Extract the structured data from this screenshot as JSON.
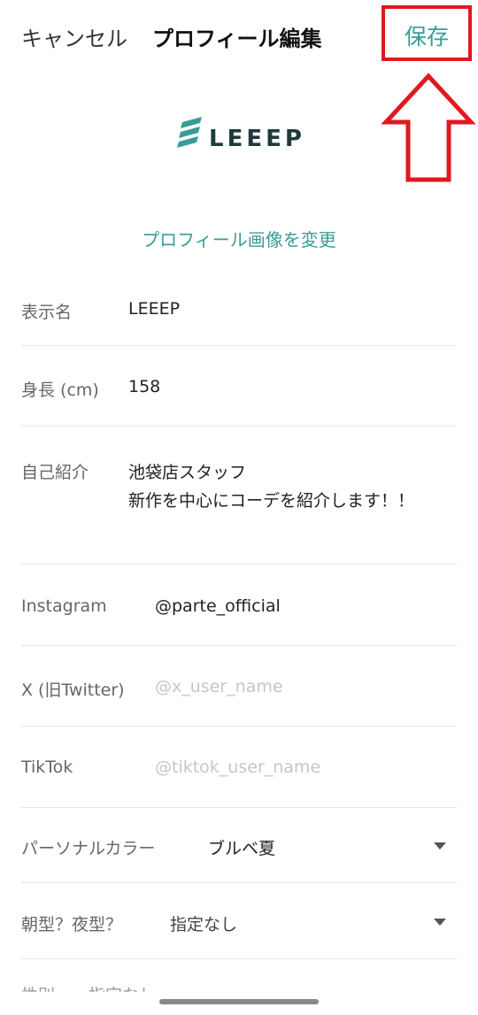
{
  "header": {
    "cancel_label": "キャンセル",
    "title": "プロフィール編集",
    "save_label": "保存"
  },
  "logo": {
    "text": "LEEEP"
  },
  "profile": {
    "change_photo_label": "プロフィール画像を変更"
  },
  "fields": {
    "display_name": {
      "label": "表示名",
      "value": "LEEEP"
    },
    "height": {
      "label": "身長 (cm)",
      "value": "158"
    },
    "bio": {
      "label": "自己紹介",
      "line1": "池袋店スタッフ",
      "line2": "新作を中心にコーデを紹介します！！"
    },
    "instagram": {
      "label": "Instagram",
      "value": "@parte_official"
    },
    "x_twitter": {
      "label": "X (旧Twitter)",
      "placeholder": "@x_user_name"
    },
    "tiktok": {
      "label": "TikTok",
      "placeholder": "@tiktok_user_name"
    },
    "personal_color": {
      "label": "パーソナルカラー",
      "value": "ブルベ夏"
    },
    "morning_night": {
      "label": "朝型？夜型？",
      "value": "指定なし"
    },
    "gender_cutoff": {
      "text": "性別　　指定なし"
    }
  },
  "colors": {
    "accent": "#3a9c95",
    "highlight": "#e0181f"
  }
}
